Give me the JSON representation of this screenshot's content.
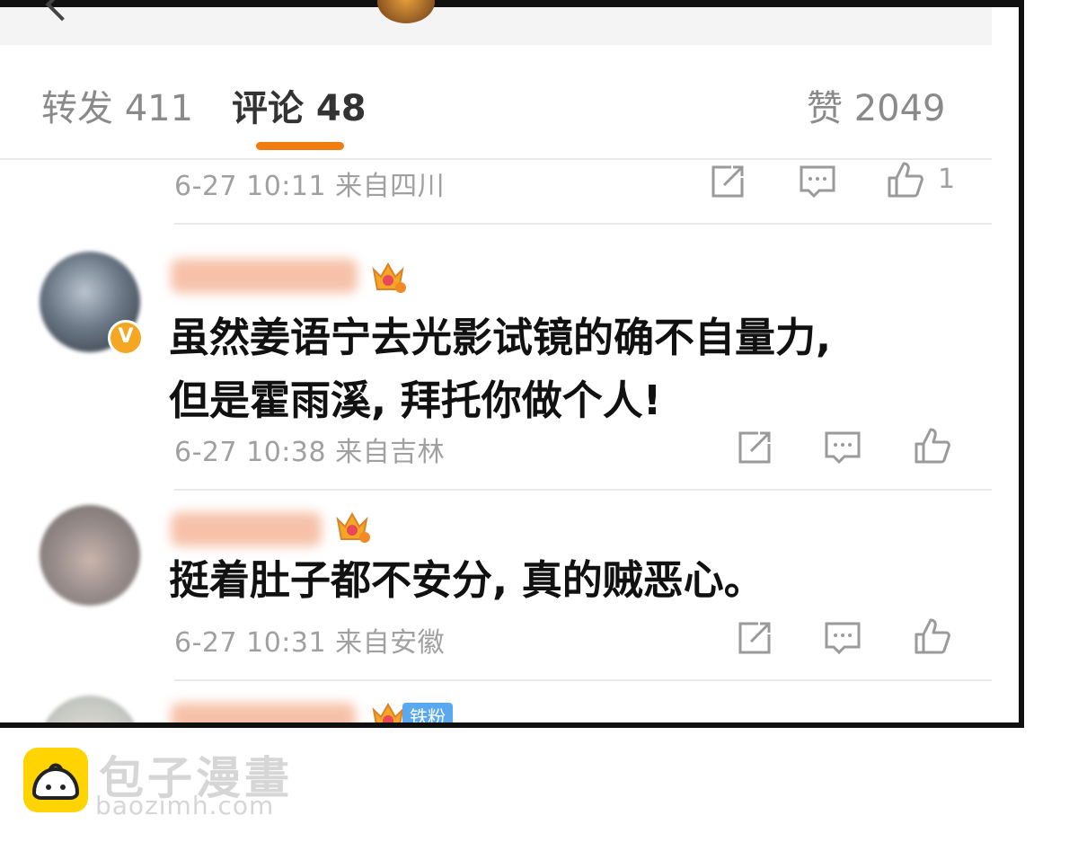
{
  "tabs": {
    "repost": "转发 411",
    "comment": "评论 48",
    "like": "赞 2049"
  },
  "comments": [
    {
      "meta": "6-27 10:11 来自四川",
      "like_count": "1"
    },
    {
      "text_line1": "虽然姜语宁去光影试镜的确不自量力,",
      "text_line2": "但是霍雨溪, 拜托你做个人!",
      "meta": "6-27 10:38 来自吉林"
    },
    {
      "text": "挺着肚子都不安分, 真的贼恶心。",
      "meta": "6-27 10:31 来自安徽"
    },
    {
      "badge": "铁粉"
    }
  ],
  "badges": {
    "verified": "V"
  },
  "watermark": {
    "name": "包子漫畫",
    "url": "baozimh.com"
  },
  "colors": {
    "accent": "#f07b0f",
    "meta_gray": "#a0a0a0",
    "crown_gold": "#f5a623",
    "badge_blue": "#5aa9f0"
  },
  "icons": [
    "back-arrow-icon",
    "repost-icon",
    "comment-icon",
    "like-icon",
    "crown-icon",
    "verified-icon"
  ]
}
